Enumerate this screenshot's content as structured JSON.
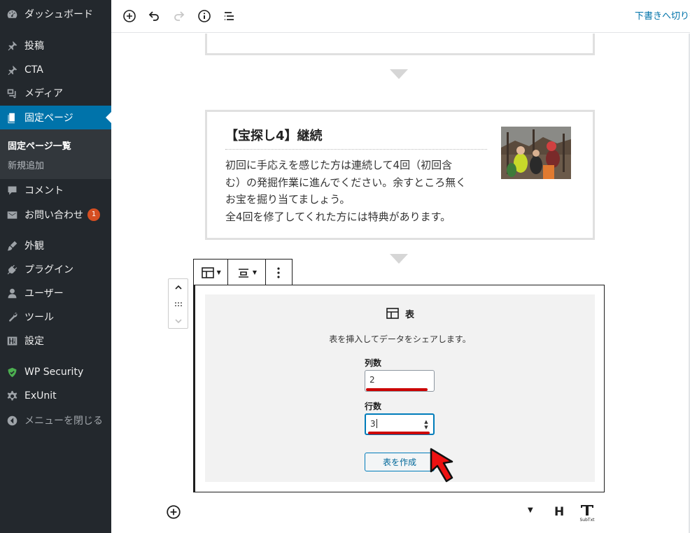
{
  "sidebar": {
    "dashboard": "ダッシュボード",
    "posts": "投稿",
    "cta": "CTA",
    "media": "メディア",
    "pages": "固定ページ",
    "pages_list": "固定ページ一覧",
    "pages_new": "新規追加",
    "comments": "コメント",
    "contact": "お問い合わせ",
    "contact_badge": "1",
    "appearance": "外観",
    "plugins": "プラグイン",
    "users": "ユーザー",
    "tools": "ツール",
    "settings": "設定",
    "wp_security": "WP Security",
    "exunit": "ExUnit",
    "collapse": "メニューを閉じる"
  },
  "topbar": {
    "draft_link": "下書きへ切り替え"
  },
  "step": {
    "title": "【宝探し4】継続",
    "body_line1": "初回に手応えを感じた方は連続して4回（初回含",
    "body_line2": "む）の発掘作業に進んでください。余すところ無く",
    "body_line3": "お宝を掘り当てましょう。",
    "body_line4": "全4回を修了してくれた方には特典があります。"
  },
  "table_block": {
    "title": "表",
    "description": "表を挿入してデータをシェアします。",
    "columns_label": "列数",
    "columns_value": "2",
    "rows_label": "行数",
    "rows_value": "3",
    "create_button": "表を作成"
  },
  "bottom": {
    "heading_button": "H",
    "subtext_label": "SubTxt"
  },
  "colors": {
    "sidebar_bg": "#23282d",
    "active": "#0073aa",
    "badge": "#d54e21",
    "highlight": "#cc0000"
  }
}
